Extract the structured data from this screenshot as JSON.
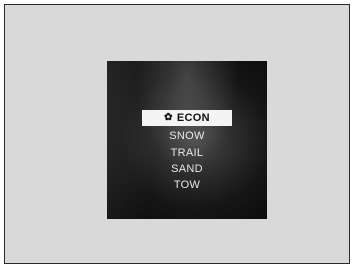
{
  "screen": {
    "modes": [
      {
        "label": "",
        "state": "faded"
      },
      {
        "label": "",
        "state": "faded"
      },
      {
        "label": "ECON",
        "state": "selected"
      },
      {
        "label": "SNOW",
        "state": "normal"
      },
      {
        "label": "TRAIL",
        "state": "normal"
      },
      {
        "label": "SAND",
        "state": "normal"
      },
      {
        "label": "TOW",
        "state": "normal"
      }
    ],
    "selected_icon": "econ-leaf-icon",
    "colors": {
      "highlight_bg": "#f4f4f4",
      "highlight_text": "#111111",
      "menu_text": "#e8e8e8",
      "page_bg": "#d9d9d9"
    }
  }
}
